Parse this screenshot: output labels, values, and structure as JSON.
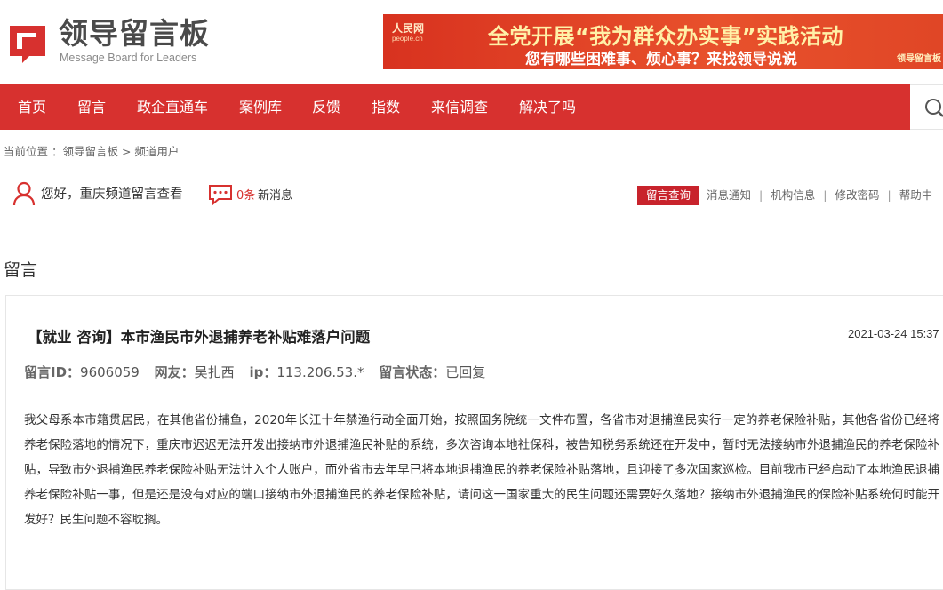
{
  "header": {
    "logo_cn": "领导留言板",
    "logo_en": "Message Board for Leaders",
    "banner": {
      "brand": "人民网",
      "brand_sub": "people.cn",
      "title": "全党开展“我为群众办实事”实践活动",
      "subtitle": "您有哪些困难事、烦心事？来找领导说说",
      "tag": "领导留言板"
    }
  },
  "nav": {
    "items": [
      "首页",
      "留言",
      "政企直通车",
      "案例库",
      "反馈",
      "指数",
      "来信调查",
      "解决了吗"
    ]
  },
  "breadcrumb": "当前位置 ：领导留言板 > 频道用户",
  "userbar": {
    "greeting": "您好，重庆频道留言查看",
    "msg_count": "0条",
    "msg_label": "新消息",
    "links": [
      "留言查询",
      "消息通知",
      "机构信息",
      "修改密码",
      "帮助中"
    ]
  },
  "section_title": "留言",
  "message": {
    "title": "【就业 咨询】本市渔民市外退捕养老补贴难落户问题",
    "date": "2021-03-24 15:37",
    "id_label": "留言ID：",
    "id_value": "9606059",
    "user_label": "网友：",
    "user_value": "吴扎西",
    "ip_label": "ip：",
    "ip_value": "113.206.53.*",
    "status_label": "留言状态：",
    "status_value": "已回复",
    "body": "我父母系本市籍贯居民，在其他省份捕鱼，2020年长江十年禁渔行动全面开始，按照国务院统一文件布置，各省市对退捕渔民实行一定的养老保险补贴，其他各省份已经将养老保险落地的情况下，重庆市迟迟无法开发出接纳市外退捕渔民补贴的系统，多次咨询本地社保科，被告知税务系统还在开发中，暂时无法接纳市外退捕渔民的养老保险补贴，导致市外退捕渔民养老保险补贴无法计入个人账户，而外省市去年早已将本地退捕渔民的养老保险补贴落地，且迎接了多次国家巡检。目前我市已经启动了本地渔民退捕养老保险补贴一事，但是还是没有对应的端口接纳市外退捕渔民的养老保险补贴，请问这一国家重大的民生问题还需要好久落地？接纳市外退捕渔民的保险补贴系统何时能开发好？民生问题不容耽搁。"
  },
  "colors": {
    "accent": "#d7312f",
    "query_button": "#c8232c"
  }
}
